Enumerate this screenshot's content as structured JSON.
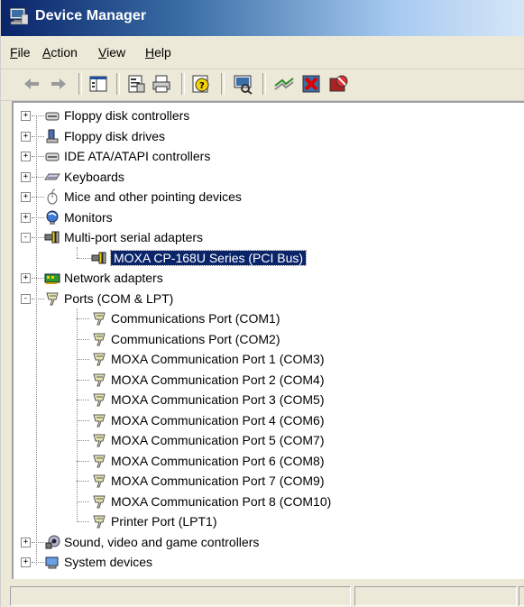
{
  "window": {
    "title": "Device Manager"
  },
  "menu": [
    {
      "accel": "F",
      "rest": "ile"
    },
    {
      "accel": "A",
      "rest": "ction"
    },
    {
      "accel": "V",
      "rest": "iew"
    },
    {
      "accel": "H",
      "rest": "elp"
    }
  ],
  "toolbar": {
    "buttons": [
      "back-icon",
      "forward-icon",
      "show-hide-tree-icon",
      "properties-icon",
      "print-icon",
      "help-icon",
      "scan-hardware-icon",
      "update-driver-icon",
      "uninstall-icon",
      "disable-icon"
    ]
  },
  "tree": {
    "floppy_controllers": "Floppy disk controllers",
    "floppy_drives": "Floppy disk drives",
    "ide": "IDE ATA/ATAPI controllers",
    "keyboards": "Keyboards",
    "mice": "Mice and other pointing devices",
    "monitors": "Monitors",
    "multiport": "Multi-port serial adapters",
    "moxa_adapter": "MOXA CP-168U Series (PCI Bus)",
    "network": "Network adapters",
    "ports": "Ports (COM & LPT)",
    "port_children": [
      "Communications Port (COM1)",
      "Communications Port (COM2)",
      "MOXA Communication Port 1 (COM3)",
      "MOXA Communication Port 2 (COM4)",
      "MOXA Communication Port 3 (COM5)",
      "MOXA Communication Port 4 (COM6)",
      "MOXA Communication Port 5 (COM7)",
      "MOXA Communication Port 6 (COM8)",
      "MOXA Communication Port 7 (COM9)",
      "MOXA Communication Port 8 (COM10)",
      "Printer Port (LPT1)"
    ],
    "sound": "Sound, video and game controllers",
    "system": "System devices"
  },
  "colors": {
    "selection": "#0a246a",
    "titlebar": "#0a246a"
  }
}
